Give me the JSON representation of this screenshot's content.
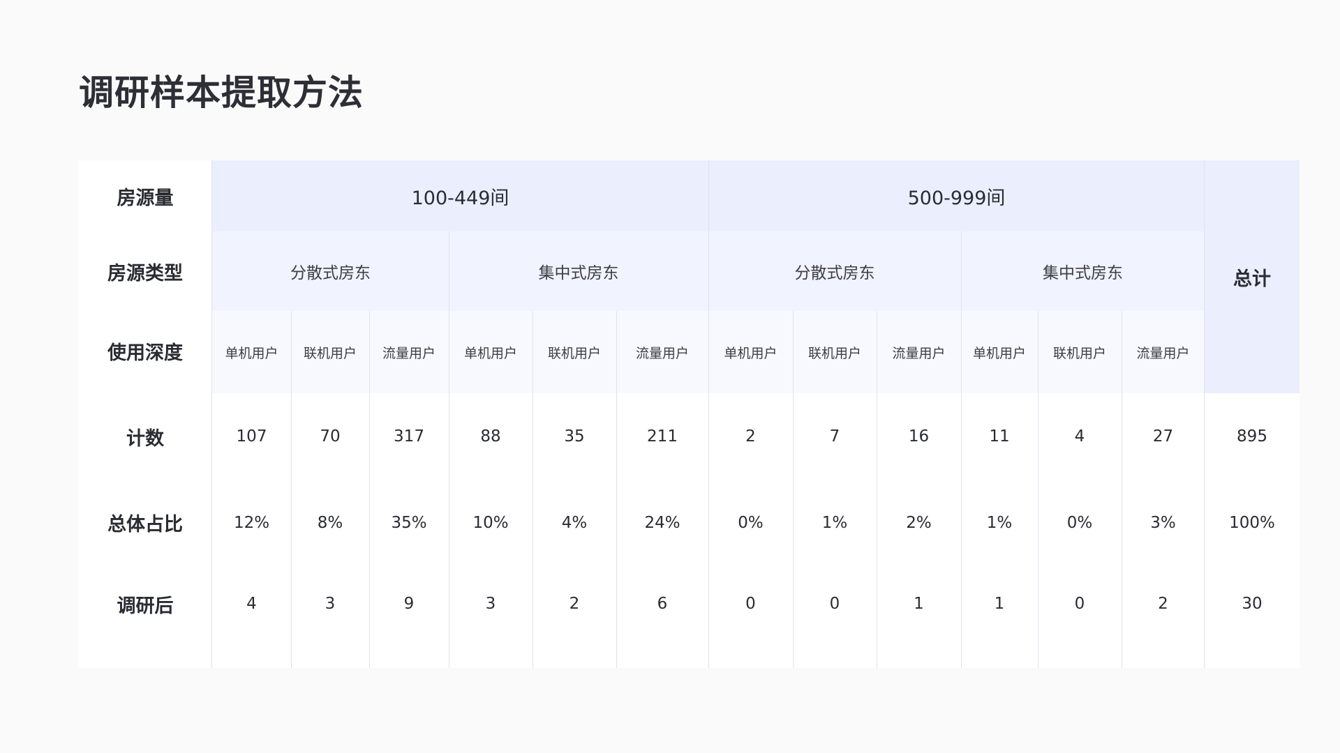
{
  "title": "调研样本提取方法",
  "table": {
    "row_labels": {
      "range": "房源量",
      "type": "房源类型",
      "depth": "使用深度",
      "count": "计数",
      "ratio": "总体占比",
      "after": "调研后"
    },
    "total_header": "总计",
    "groups": [
      {
        "range": "100-449间",
        "types": [
          {
            "name": "分散式房东",
            "depths": [
              "单机用户",
              "联机用户",
              "流量用户"
            ]
          },
          {
            "name": "集中式房东",
            "depths": [
              "单机用户",
              "联机用户",
              "流量用户"
            ]
          }
        ]
      },
      {
        "range": "500-999间",
        "types": [
          {
            "name": "分散式房东",
            "depths": [
              "单机用户",
              "联机用户",
              "流量用户"
            ]
          },
          {
            "name": "集中式房东",
            "depths": [
              "单机用户",
              "联机用户",
              "流量用户"
            ]
          }
        ]
      }
    ],
    "counts": [
      "107",
      "70",
      "317",
      "88",
      "35",
      "211",
      "2",
      "7",
      "16",
      "11",
      "4",
      "27"
    ],
    "count_total": "895",
    "ratios": [
      "12%",
      "8%",
      "35%",
      "10%",
      "4%",
      "24%",
      "0%",
      "1%",
      "2%",
      "1%",
      "0%",
      "3%"
    ],
    "ratio_total": "100%",
    "after": [
      "4",
      "3",
      "9",
      "3",
      "2",
      "6",
      "0",
      "0",
      "1",
      "1",
      "0",
      "2"
    ],
    "after_total": "30"
  }
}
